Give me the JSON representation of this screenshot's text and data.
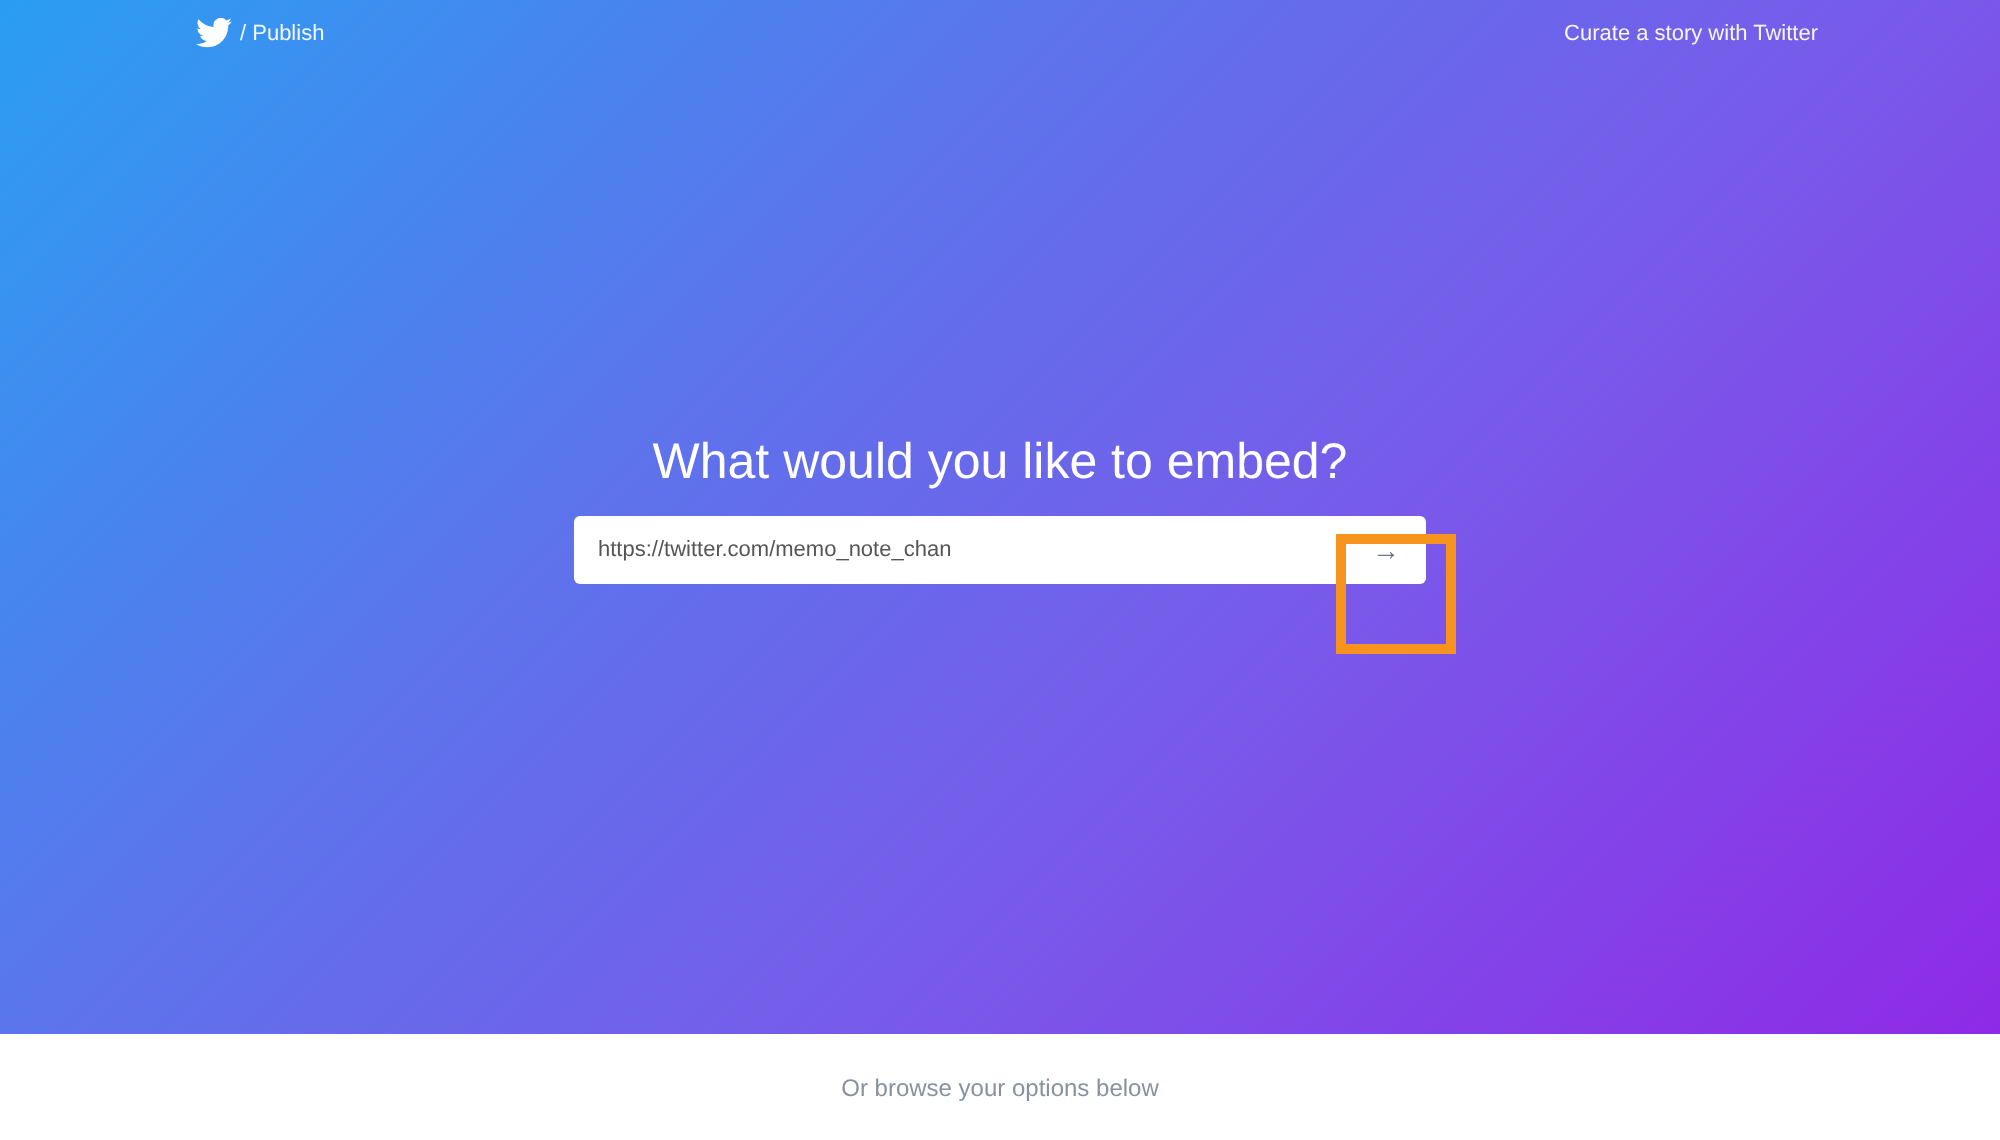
{
  "header": {
    "brand": "/ Publish",
    "link": "Curate a story with Twitter"
  },
  "hero": {
    "title": "What would you like to embed?",
    "url_field": {
      "value": "https://twitter.com/memo_note_chan"
    },
    "submit": "→"
  },
  "footer": {
    "text": "Or browse your options below"
  }
}
